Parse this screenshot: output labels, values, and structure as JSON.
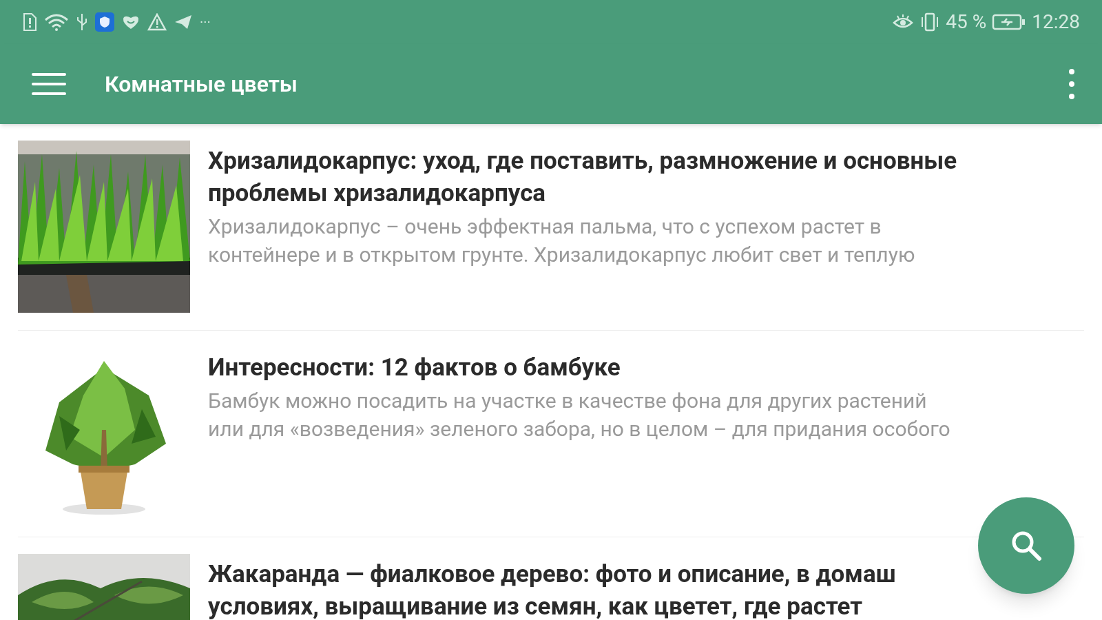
{
  "status_bar": {
    "notifications_more": "···",
    "battery_percent": "45 %",
    "time": "12:28"
  },
  "app_bar": {
    "title": "Комнатные цветы"
  },
  "articles": [
    {
      "thumbnail": {
        "kind": "picture"
      },
      "title_lines": [
        "Хризалидокарпус: уход, где поставить, размножение и основные",
        "проблемы хризалидокарпуса"
      ],
      "desc_lines": [
        "Хризалидокарпус – очень эффектная пальма, что с успехом растет в",
        "контейнере и в открытом грунте. Хризалидокарпус любит свет и теплую"
      ]
    },
    {
      "thumbnail": {
        "kind": "picture"
      },
      "title_lines": [
        "Интересности: 12 фактов о бамбуке"
      ],
      "desc_lines": [
        "Бамбук можно посадить на участке в качестве фона для других растений",
        "или для «возведения» зеленого забора, но в целом – для придания особого"
      ]
    },
    {
      "thumbnail": {
        "kind": "picture"
      },
      "title_lines": [
        "Жакаранда — фиалковое дерево: фото и описание, в домаш",
        "условиях, выращивание из семян, как цветет, где растет"
      ]
    }
  ]
}
